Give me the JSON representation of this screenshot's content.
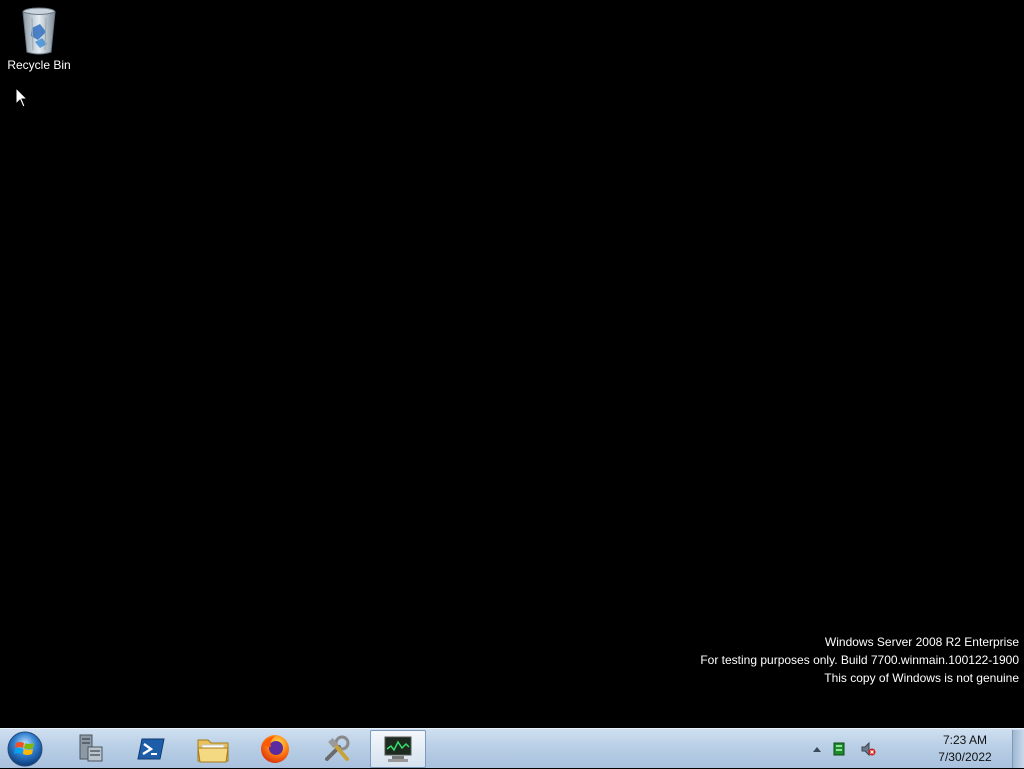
{
  "desktop": {
    "icons": [
      {
        "label": "Recycle Bin",
        "icon": "recycle-bin-icon"
      }
    ],
    "background_color": "#000000"
  },
  "watermark": {
    "line1": "Windows Server 2008 R2 Enterprise",
    "line2": "For testing purposes only. Build 7700.winmain.100122-1900",
    "line3": "This copy of Windows is not genuine"
  },
  "taskbar": {
    "start_icon": "windows-orb-icon",
    "pinned": [
      {
        "name": "server-manager",
        "icon": "server-manager-icon"
      },
      {
        "name": "powershell",
        "icon": "powershell-icon"
      },
      {
        "name": "windows-explorer",
        "icon": "folder-icon"
      },
      {
        "name": "firefox",
        "icon": "firefox-icon"
      },
      {
        "name": "tools",
        "icon": "tools-icon"
      },
      {
        "name": "system-monitor",
        "icon": "monitor-icon",
        "active": true
      }
    ],
    "tray": {
      "icons": [
        "show-hidden-icons-arrow",
        "network-icon",
        "volume-muted-icon"
      ]
    },
    "clock": {
      "time": "7:23 AM",
      "date": "7/30/2022"
    }
  }
}
